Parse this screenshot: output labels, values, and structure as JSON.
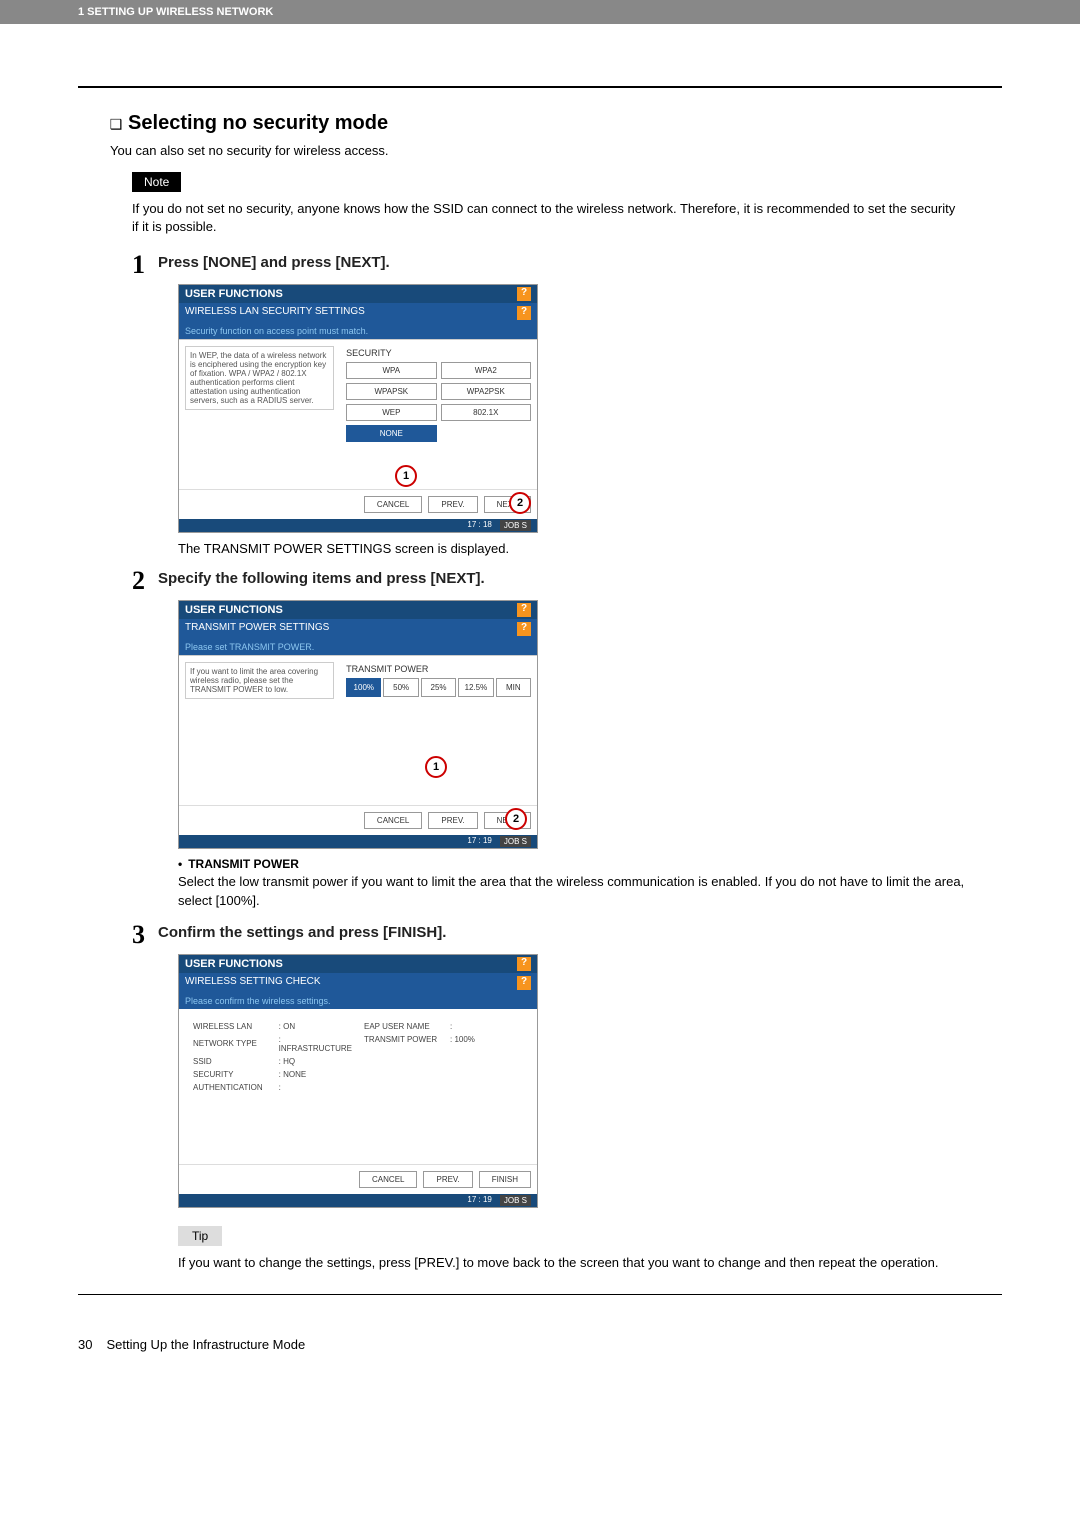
{
  "header": {
    "chapter": "1 SETTING UP WIRELESS NETWORK"
  },
  "section": {
    "title_prefix": "❑",
    "title": "Selecting no security mode",
    "intro": "You can also set no security for wireless access.",
    "note_label": "Note",
    "note_text": "If you do not set no security, anyone knows how the SSID can connect to the wireless network.  Therefore, it is recommended to set the security if it is possible."
  },
  "steps": [
    {
      "num": "1",
      "title": "Press [NONE] and press [NEXT].",
      "caption": "The TRANSMIT POWER SETTINGS screen is displayed.",
      "screen": {
        "window_title": "USER FUNCTIONS",
        "sub_title": "WIRELESS LAN SECURITY SETTINGS",
        "hint": "Security function on access point must match.",
        "left_text": "In WEP, the data of a wireless network is enciphered using the encryption key of fixation. WPA / WPA2 / 802.1X authentication performs client attestation using authentication servers, such as a RADIUS server.",
        "right_label": "SECURITY",
        "buttons": [
          "WPA",
          "WPA2",
          "WPAPSK",
          "WPA2PSK",
          "WEP",
          "802.1X",
          "NONE"
        ],
        "selected": "NONE",
        "footer": [
          "CANCEL",
          "PREV.",
          "NEXT"
        ],
        "status_time": "17 : 18",
        "status_jobs": "JOB S"
      }
    },
    {
      "num": "2",
      "title": "Specify the following items and press [NEXT].",
      "bullet_label": "TRANSMIT POWER",
      "bullet_text": "Select the low transmit power if you want to limit the area that the wireless communication is enabled. If you do not have to limit the area, select [100%].",
      "screen": {
        "window_title": "USER FUNCTIONS",
        "sub_title": "TRANSMIT POWER SETTINGS",
        "hint": "Please set TRANSMIT POWER.",
        "left_text": "If you want to limit the area covering wireless radio, please set the TRANSMIT POWER to low.",
        "right_label": "TRANSMIT POWER",
        "power_opts": [
          "100%",
          "50%",
          "25%",
          "12.5%",
          "MIN"
        ],
        "selected": "100%",
        "footer": [
          "CANCEL",
          "PREV.",
          "NEXT"
        ],
        "status_time": "17 : 19",
        "status_jobs": "JOB S"
      }
    },
    {
      "num": "3",
      "title": "Confirm the settings and press [FINISH].",
      "tip_label": "Tip",
      "tip_text": "If you want to change the settings, press [PREV.] to move back to the screen that you want to change and then repeat the operation.",
      "screen": {
        "window_title": "USER FUNCTIONS",
        "sub_title": "WIRELESS SETTING CHECK",
        "hint": "Please confirm the wireless settings.",
        "left_rows": [
          [
            "WIRELESS LAN",
            ": ON"
          ],
          [
            "NETWORK TYPE",
            ": INFRASTRUCTURE"
          ],
          [
            "SSID",
            ": HQ"
          ],
          [
            "SECURITY",
            ": NONE"
          ],
          [
            "AUTHENTICATION",
            ": "
          ]
        ],
        "right_rows": [
          [
            "EAP USER NAME",
            ": "
          ],
          [
            "TRANSMIT POWER",
            ": 100%"
          ]
        ],
        "footer": [
          "CANCEL",
          "PREV.",
          "FINISH"
        ],
        "status_time": "17 : 19",
        "status_jobs": "JOB S"
      }
    }
  ],
  "footer": {
    "page": "30",
    "title": "Setting Up the Infrastructure Mode"
  },
  "pointers": {
    "one": "1",
    "two": "2"
  }
}
